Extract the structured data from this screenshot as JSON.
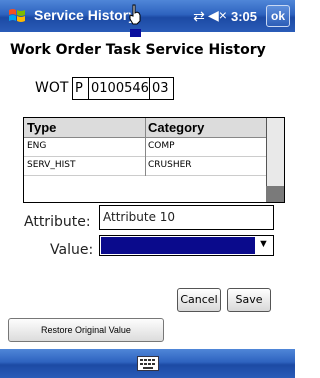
{
  "titlebar": {
    "title": "Service History",
    "time": "3:05",
    "ok_label": "ok",
    "start_icon": "windows-flag-icon",
    "sync_icon": "sync-icon",
    "volume_icon": "volume-muted-icon"
  },
  "page": {
    "title": "Work Order Task Service History"
  },
  "wot": {
    "label": "WOT",
    "type": "P",
    "number": "0100546",
    "task": "03"
  },
  "grid": {
    "columns": [
      "Type",
      "Category"
    ],
    "rows": [
      [
        "ENG",
        "COMP"
      ],
      [
        "SERV_HIST",
        "CRUSHER"
      ]
    ]
  },
  "attribute": {
    "label": "Attribute:",
    "value": "Attribute 10"
  },
  "value_field": {
    "label": "Value:",
    "selected": ""
  },
  "buttons": {
    "cancel": "Cancel",
    "save": "Save",
    "restore": "Restore Original Value"
  },
  "colors": {
    "titlebar": "#2e63bf",
    "value_highlight": "#0a0a8c"
  }
}
